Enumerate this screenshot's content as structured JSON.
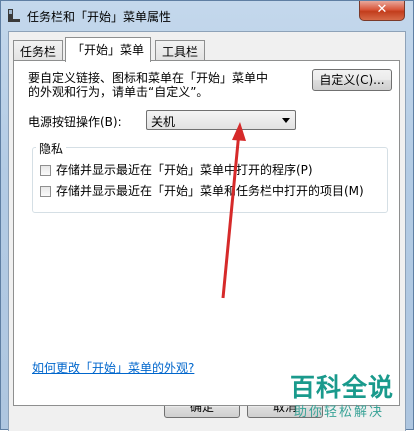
{
  "window": {
    "title": "任务栏和「开始」菜单属性",
    "close_glyph": "✕"
  },
  "tabs": [
    {
      "label": "任务栏"
    },
    {
      "label": "「开始」菜单"
    },
    {
      "label": "工具栏"
    }
  ],
  "start_menu": {
    "description": "要自定义链接、图标和菜单在「开始」菜单中的外观和行为，请单击“自定义”。",
    "customize_button": "自定义(C)...",
    "power_label": "电源按钮操作(B):",
    "power_value": "关机",
    "privacy_title": "隐私",
    "privacy_options": [
      {
        "label": "存储并显示最近在「开始」菜单中打开的程序(P)",
        "checked": false
      },
      {
        "label": "存储并显示最近在「开始」菜单和任务栏中打开的项目(M)",
        "checked": false
      }
    ],
    "help_link": "如何更改「开始」菜单的外观?"
  },
  "footer": {
    "ok_button": "确定",
    "cancel_button": "取消"
  },
  "watermark": {
    "main": "百科全说",
    "sub": "助你轻松解决"
  },
  "colors": {
    "annotation_arrow": "#d62a2a",
    "link": "#0066cc",
    "watermark": "#1a9a8c"
  }
}
